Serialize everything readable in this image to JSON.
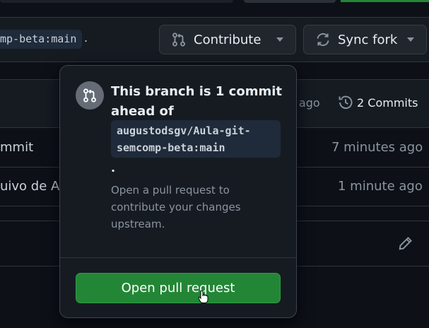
{
  "header": {
    "branch_ref": "mp-beta:main",
    "branch_period": "."
  },
  "toolbar": {
    "contribute_label": "Contribute",
    "sync_label": "Sync fork"
  },
  "table": {
    "head_time": "e ago",
    "commits_label": "2 Commits",
    "rows": [
      {
        "message": "mmit",
        "time": "7 minutes ago"
      },
      {
        "message": "uivo de Au",
        "time": "1 minute ago"
      }
    ]
  },
  "popover": {
    "title": "This branch is 1 commit ahead of",
    "code": "augustodsgv/Aula-git-semcomp-beta:main",
    "period": ".",
    "description": "Open a pull request to contribute your changes upstream.",
    "button_label": "Open pull request"
  },
  "colors": {
    "background": "#0d1117",
    "accent_green": "#238636",
    "panel": "#161b22"
  }
}
